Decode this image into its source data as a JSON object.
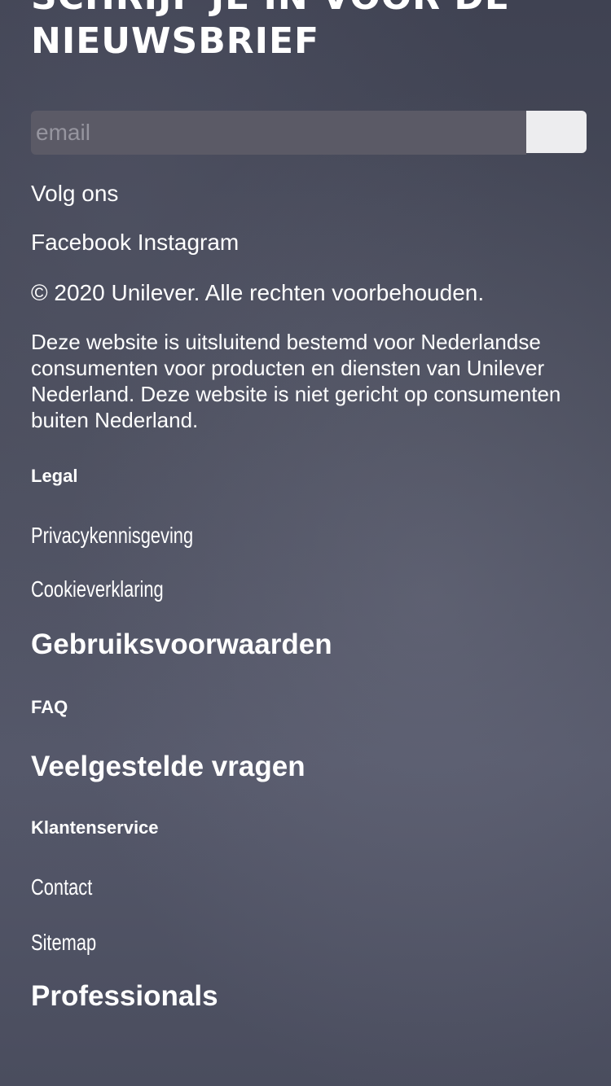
{
  "newsletter": {
    "title_line1": "SCHRIJF JE IN VOOR DE",
    "title_line2": "NIEUWSBRIEF",
    "email_placeholder": "email",
    "submit_label": ""
  },
  "social": {
    "heading": "Volg ons",
    "links": [
      "Facebook",
      "Instagram"
    ]
  },
  "copyright": "© 2020 Unilever. Alle rechten voorbehouden.",
  "disclaimer": "Deze website is uitsluitend bestemd voor Nederlandse consumenten voor producten en diensten van Unilever Nederland. Deze website is niet gericht op consumenten buiten Nederland.",
  "legal": {
    "heading": "Legal",
    "links": [
      "Privacykennisgeving",
      "Cookieverklaring",
      "Gebruiksvoorwaarden"
    ]
  },
  "faq": {
    "heading": "FAQ",
    "links": [
      "Veelgestelde vragen"
    ]
  },
  "customer_service": {
    "heading": "Klantenservice",
    "links": [
      "Contact",
      "Sitemap",
      "Professionals"
    ]
  }
}
